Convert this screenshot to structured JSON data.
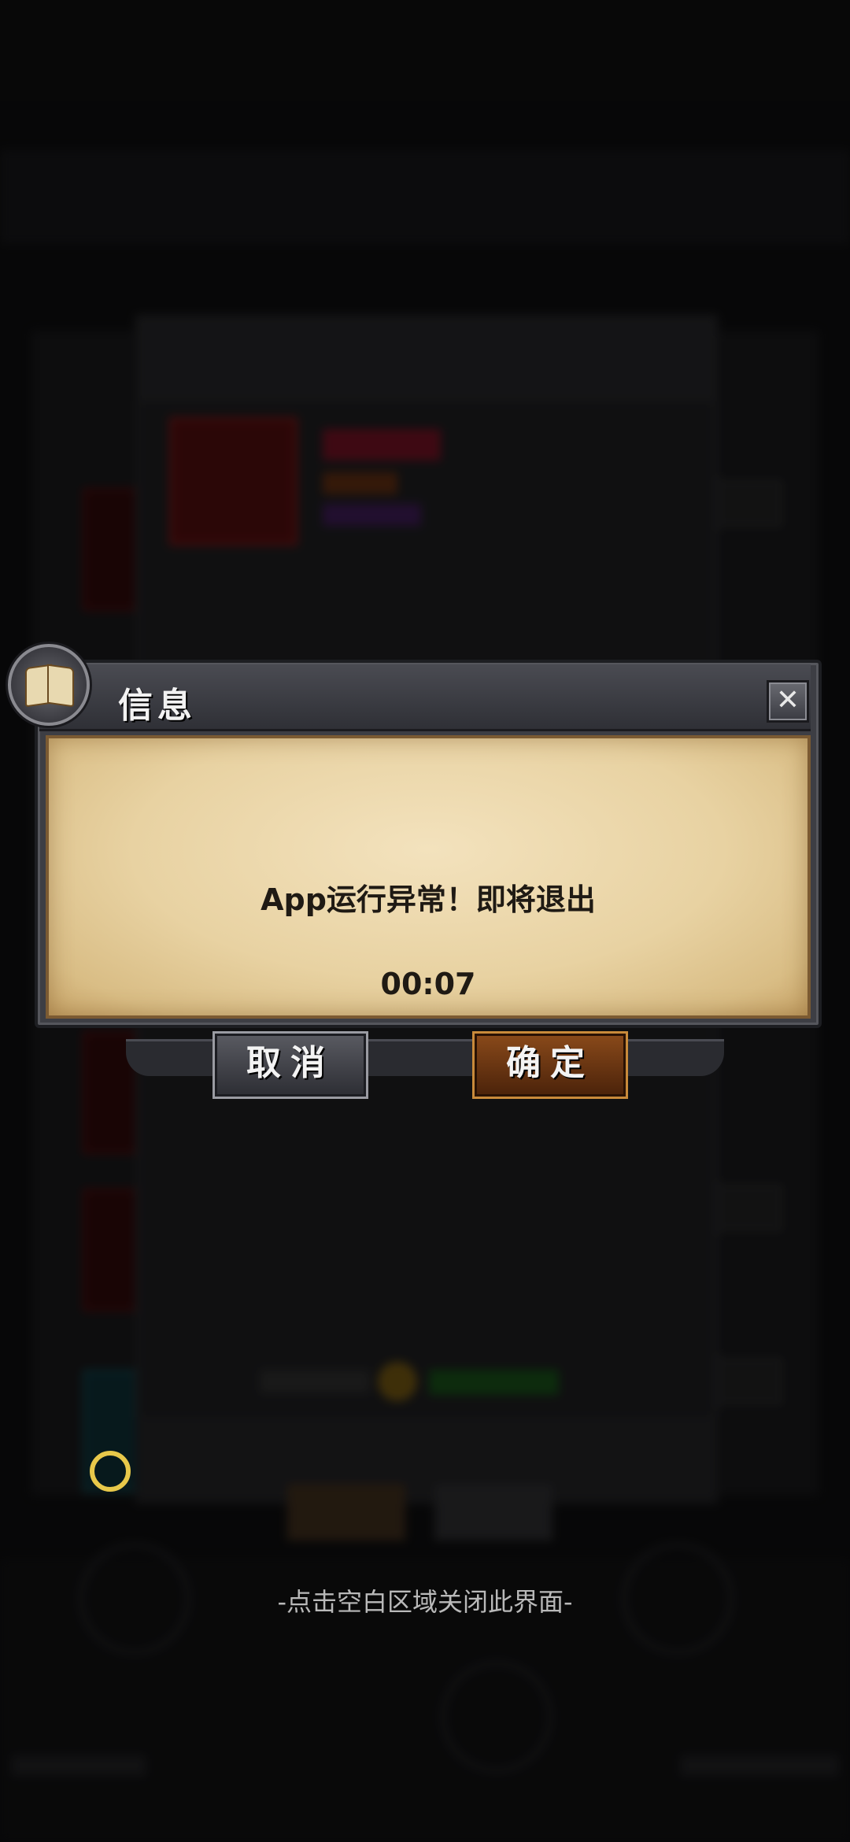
{
  "dialog": {
    "title": "信息",
    "close_label": "✕",
    "message": "App运行异常！即将退出",
    "countdown": "00:07",
    "cancel_label": "取消",
    "confirm_label": "确定"
  },
  "hint": {
    "close_text": "-点击空白区域关闭此界面-"
  },
  "colors": {
    "confirm_accent": "#c98a3a",
    "parchment": "#e8d2a2",
    "ring": "#e8c84a"
  },
  "icons": {
    "dialog_badge": "open-book-icon",
    "close": "close-icon"
  }
}
